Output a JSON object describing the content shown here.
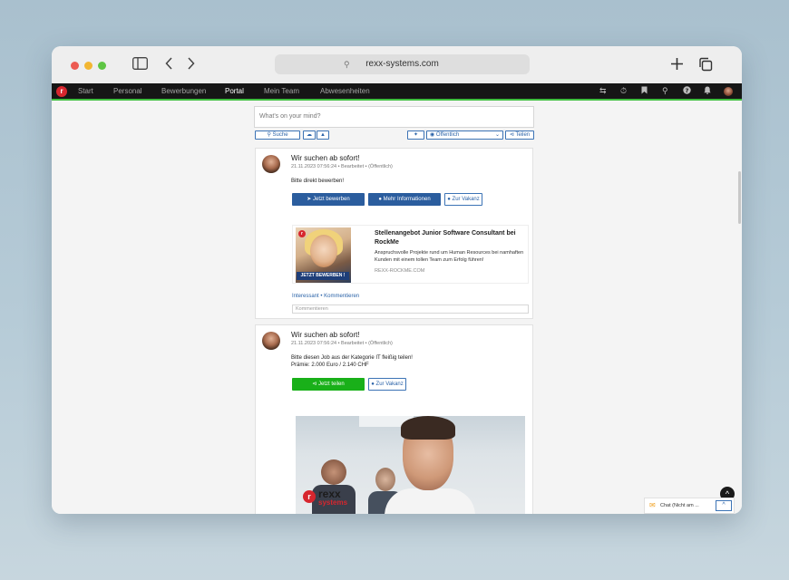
{
  "browser": {
    "url": "rexx-systems.com",
    "icons": {
      "sidebar": "sidebar-icon",
      "back": "chevron-left-icon",
      "forward": "chevron-right-icon",
      "search": "search-icon",
      "new_tab": "plus-icon",
      "tabs": "tabs-icon"
    }
  },
  "nav": {
    "logo": "r",
    "items": [
      {
        "label": "Start",
        "active": false
      },
      {
        "label": "Personal",
        "active": false
      },
      {
        "label": "Bewerbungen",
        "active": false
      },
      {
        "label": "Portal",
        "active": true
      },
      {
        "label": "Mein Team",
        "active": false
      },
      {
        "label": "Abwesenheiten",
        "active": false
      }
    ],
    "right_icons": [
      "swap-icon",
      "timer-icon",
      "bookmark-icon",
      "search-icon",
      "help-icon",
      "bell-icon",
      "avatar"
    ]
  },
  "composer": {
    "placeholder": "What's on your mind?",
    "search_label": "Suche",
    "visibility": "Öffentlich",
    "share_label": "Teilen"
  },
  "posts": [
    {
      "title": "Wir suchen ab sofort!",
      "meta": "21.11.2023 07:56:24 • Bearbeitet • (Öffentlich)",
      "body_lines": [
        "Bitte direkt bewerben!"
      ],
      "buttons": [
        "Jetzt bewerben",
        "Mehr Informationen",
        "Zur Vakanz"
      ],
      "preview": {
        "title": "Stellenangebot Junior Software Consultant bei RockMe",
        "description": "Anspruchsvolle Projekte rund um Human Resources bei namhaften Kunden mit einem tollen Team zum Erfolg führen!",
        "domain": "REXX-ROCKME.COM",
        "image_badge": "JETZT BEWERBEN !"
      },
      "links": "Interessant • Kommentieren",
      "comment_placeholder": "Kommentieren"
    },
    {
      "title": "Wir suchen ab sofort!",
      "meta": "21.11.2023 07:56:24 • Bearbeitet • (Öffentlich)",
      "body_lines": [
        "Bitte diesen Job aus der Kategorie IT fleißig teilen!",
        "Prämie: 2.000 Euro / 2.140 CHF"
      ],
      "buttons": [
        "Jetzt teilen",
        "Zur Vakanz"
      ],
      "banner": {
        "logo_line1": "rexx",
        "logo_line2": "systems"
      }
    }
  ],
  "chat": {
    "label": "Chat (Nicht am ...",
    "toggle": "^"
  },
  "scroll_top": "^"
}
